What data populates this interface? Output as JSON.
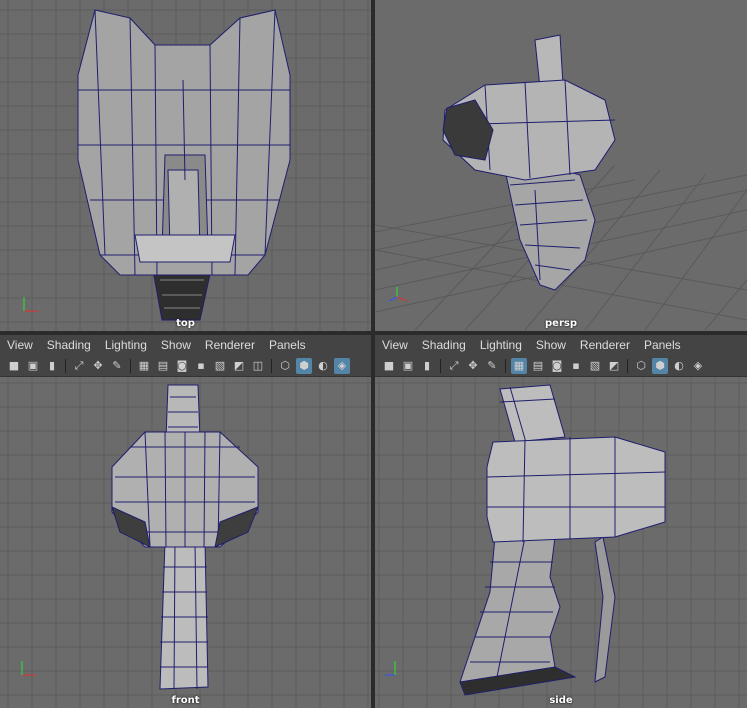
{
  "viewports": {
    "top_label": "top",
    "persp_label": "persp",
    "front_label": "front",
    "side_label": "side"
  },
  "menus": {
    "left": [
      "View",
      "Shading",
      "Lighting",
      "Show",
      "Renderer",
      "Panels"
    ],
    "right": [
      "View",
      "Shading",
      "Lighting",
      "Show",
      "Renderer",
      "Panels"
    ]
  },
  "colors": {
    "viewport_bg": "#6b6b6b",
    "grid": "#5a5a5a",
    "wire": "#1e1e6e",
    "mesh_light": "#c8c8c8",
    "mesh_mid": "#9a9a9a",
    "mesh_dark": "#3a3a3a",
    "axis_x": "#e03030",
    "axis_y": "#30e030",
    "axis_z": "#3050ff",
    "toolbar_selected": "#5285a6"
  },
  "toolbar_icons": [
    "camera-icon",
    "camera-attr-icon",
    "bookmark-icon",
    "select-camera-icon",
    "move-tool-icon",
    "paint-icon",
    "grid-toggle-icon",
    "film-gate-icon",
    "resolution-gate-icon",
    "safe-area-icon",
    "field-chart-icon",
    "texture-icon",
    "wireframe-icon",
    "smooth-shade-icon",
    "lights-icon",
    "xray-icon"
  ]
}
